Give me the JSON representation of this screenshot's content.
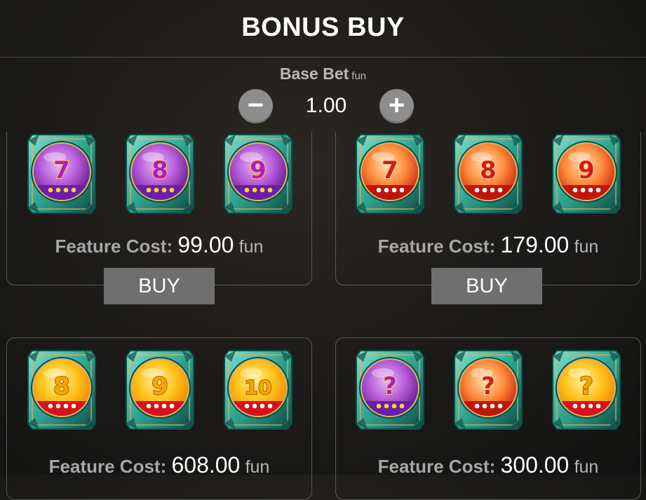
{
  "title": "BONUS BUY",
  "base_bet": {
    "label": "Base Bet",
    "unit": "fun",
    "value": "1.00",
    "minus_icon": "minus-icon",
    "plus_icon": "plus-icon"
  },
  "features": [
    {
      "symbols": [
        {
          "label": "7",
          "theme": "purple"
        },
        {
          "label": "8",
          "theme": "purple"
        },
        {
          "label": "9",
          "theme": "purple"
        }
      ],
      "cost_label": "Feature Cost:",
      "cost": "99.00",
      "currency": "fun",
      "buy_label": "BUY"
    },
    {
      "symbols": [
        {
          "label": "7",
          "theme": "red"
        },
        {
          "label": "8",
          "theme": "red"
        },
        {
          "label": "9",
          "theme": "red"
        }
      ],
      "cost_label": "Feature Cost:",
      "cost": "179.00",
      "currency": "fun",
      "buy_label": "BUY"
    },
    {
      "symbols": [
        {
          "label": "8",
          "theme": "gold"
        },
        {
          "label": "9",
          "theme": "gold"
        },
        {
          "label": "10",
          "theme": "gold"
        }
      ],
      "cost_label": "Feature Cost:",
      "cost": "608.00",
      "currency": "fun"
    },
    {
      "symbols": [
        {
          "label": "?",
          "theme": "purple"
        },
        {
          "label": "?",
          "theme": "red"
        },
        {
          "label": "?",
          "theme": "gold"
        }
      ],
      "cost_label": "Feature Cost:",
      "cost": "300.00",
      "currency": "fun"
    }
  ],
  "themes": {
    "purple": {
      "inner": "#e6b8f6",
      "mid": "#b45ad8",
      "outer": "#6a1f8e",
      "band": "#6a1fa8",
      "dot": "#ffd23a",
      "text": "#b01cc8",
      "textStroke": "#f7d24c"
    },
    "red": {
      "inner": "#ffe1b0",
      "mid": "#ff8a3a",
      "outer": "#d12d10",
      "band": "#c0160a",
      "dot": "#ffffff",
      "text": "#d41c14",
      "textStroke": "#ffd8a0"
    },
    "gold": {
      "inner": "#fff2a0",
      "mid": "#ffc21a",
      "outer": "#f08a00",
      "band": "#d5121a",
      "dot": "#ffffff",
      "text": "#f5a800",
      "textStroke": "#b85a00"
    },
    "frame": {
      "teal": "#2fa38f",
      "tealDark": "#0e4e46",
      "tealLight": "#7de0cc",
      "gold": "#d9b46a"
    }
  }
}
